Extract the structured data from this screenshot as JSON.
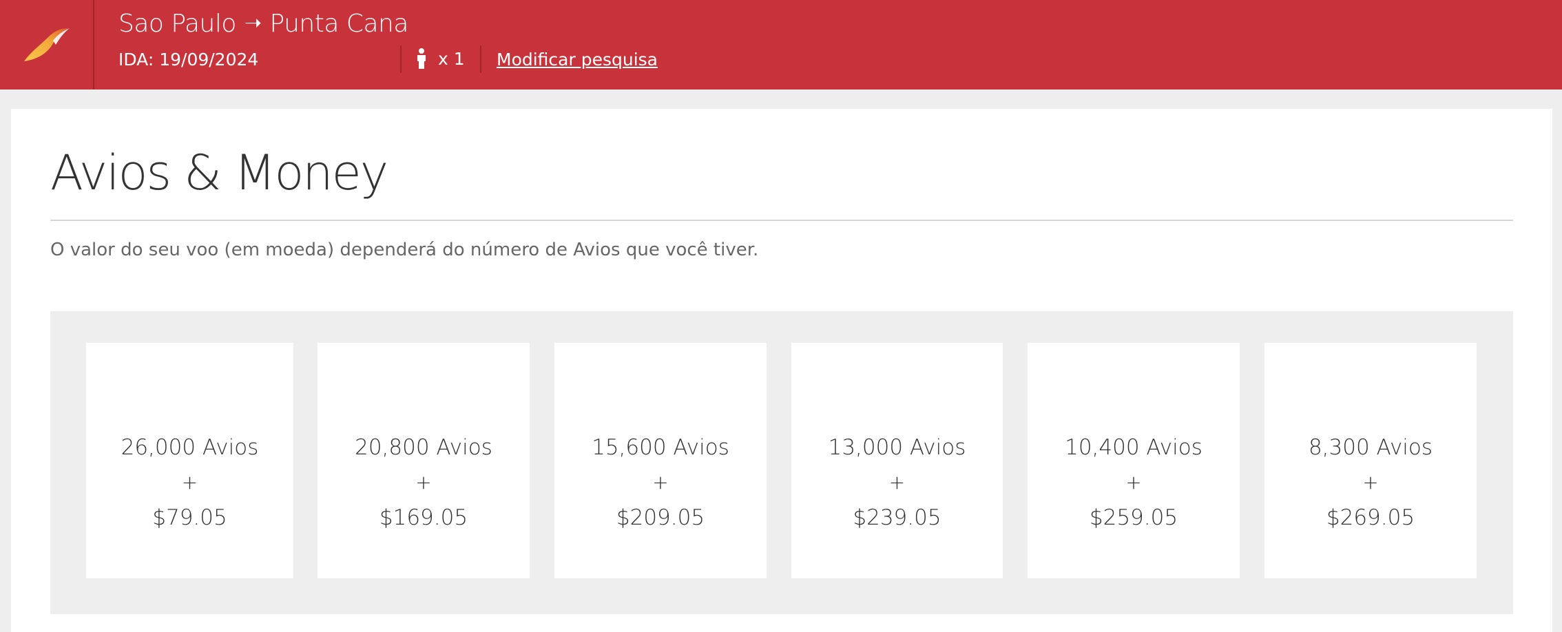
{
  "header": {
    "origin": "Sao Paulo",
    "arrow": "➝",
    "destination": "Punta Cana",
    "outbound_date": "IDA: 19/09/2024",
    "passengers": "x 1",
    "modify_link": "Modificar pesquisa",
    "logo_icon": "airline-logo-icon",
    "passenger_icon": "person-icon"
  },
  "main": {
    "title": "Avios & Money",
    "description": "O valor do seu voo (em moeda) dependerá do número de Avios que você tiver.",
    "options": [
      {
        "avios": "26,000 Avios",
        "plus": "+",
        "money": "$79.05"
      },
      {
        "avios": "20,800 Avios",
        "plus": "+",
        "money": "$169.05"
      },
      {
        "avios": "15,600 Avios",
        "plus": "+",
        "money": "$209.05"
      },
      {
        "avios": "13,000 Avios",
        "plus": "+",
        "money": "$239.05"
      },
      {
        "avios": "10,400 Avios",
        "plus": "+",
        "money": "$259.05"
      },
      {
        "avios": "8,300 Avios",
        "plus": "+",
        "money": "$269.05"
      }
    ]
  },
  "colors": {
    "brand_red": "#c8323a",
    "page_bg": "#eeeeee",
    "logo_gold": "#f2b233",
    "logo_orange": "#e8762d"
  }
}
